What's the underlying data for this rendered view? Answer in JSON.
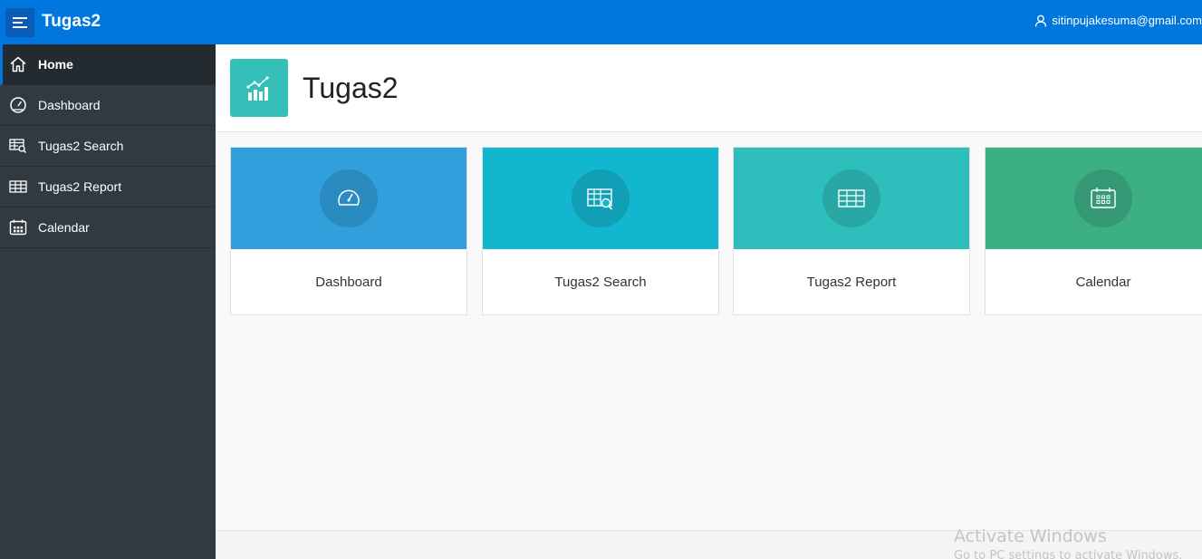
{
  "header": {
    "app_title": "Tugas2",
    "user_email": "sitinpujakesuma@gmail.com",
    "color": "#0076df"
  },
  "sidebar": {
    "items": [
      {
        "label": "Home",
        "icon": "home-icon",
        "active": true
      },
      {
        "label": "Dashboard",
        "icon": "dashboard-icon",
        "active": false
      },
      {
        "label": "Tugas2 Search",
        "icon": "table-search-icon",
        "active": false
      },
      {
        "label": "Tugas2 Report",
        "icon": "table-icon",
        "active": false
      },
      {
        "label": "Calendar",
        "icon": "calendar-icon",
        "active": false
      }
    ]
  },
  "main": {
    "page_title": "Tugas2",
    "title_icon": "chart-icon",
    "cards": [
      {
        "label": "Dashboard",
        "icon": "dashboard-icon",
        "color": "#309fdb"
      },
      {
        "label": "Tugas2 Search",
        "icon": "table-search-icon",
        "color": "#13b6cf"
      },
      {
        "label": "Tugas2 Report",
        "icon": "table-icon",
        "color": "#2ebfbc"
      },
      {
        "label": "Calendar",
        "icon": "calendar-icon",
        "color": "#3caf85"
      }
    ]
  },
  "watermark": {
    "line1": "Activate Windows",
    "line2": "Go to PC settings to activate Windows."
  }
}
